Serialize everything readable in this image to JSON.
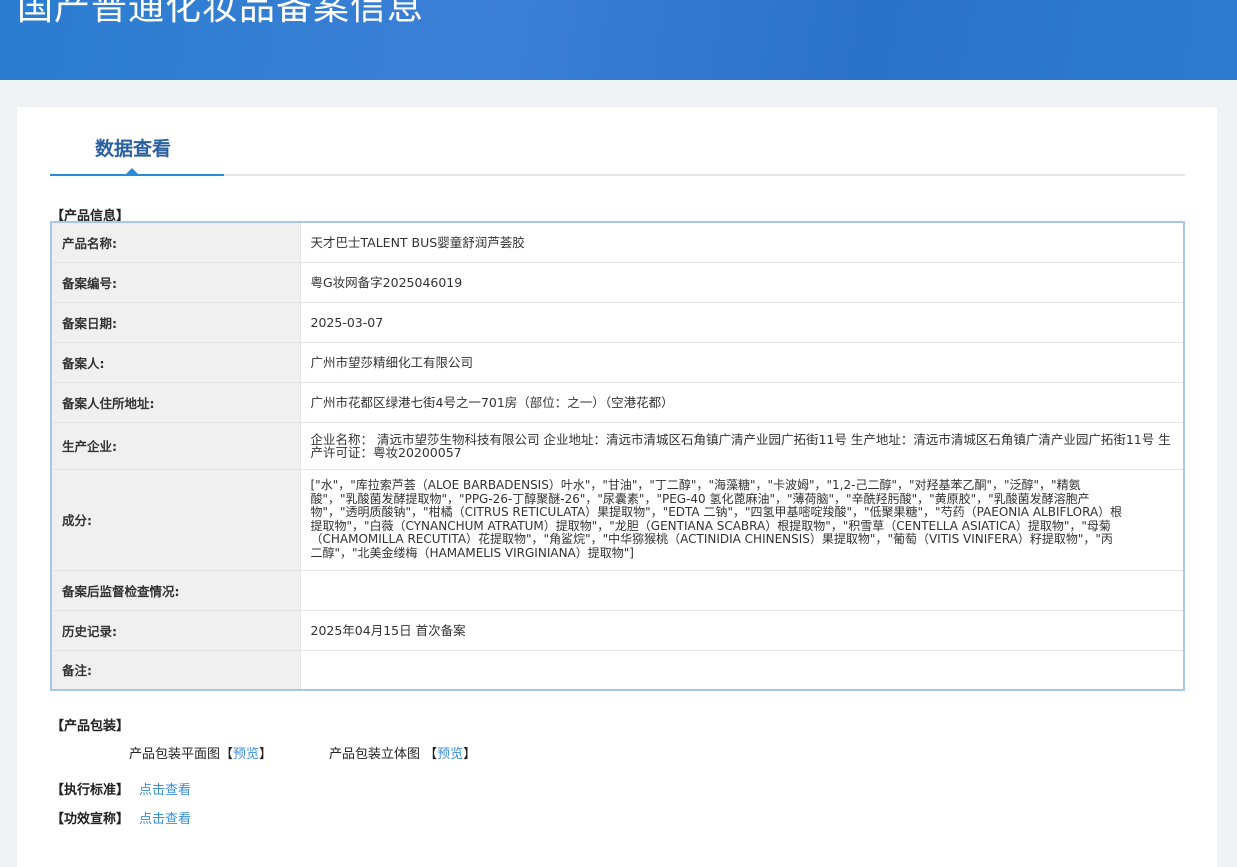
{
  "header": {
    "title": "国产普通化妆品备案信息"
  },
  "tab": {
    "label": "数据查看"
  },
  "product_info": {
    "section_title": "【产品信息】",
    "rows": [
      {
        "label": "产品名称:",
        "value": "天才巴士TALENT BUS婴童舒润芦荟胶"
      },
      {
        "label": "备案编号:",
        "value": "粤G妆网备字2025046019"
      },
      {
        "label": "备案日期:",
        "value": "2025-03-07"
      },
      {
        "label": "备案人:",
        "value": "广州市望莎精细化工有限公司"
      },
      {
        "label": "备案人住所地址:",
        "value": "广州市花都区绿港七街4号之一701房（部位：之一）（空港花都）"
      },
      {
        "label": "生产企业:",
        "value": "企业名称： 清远市望莎生物科技有限公司 企业地址：清远市清城区石角镇广清产业园广拓街11号 生产地址：清远市清城区石角镇广清产业园广拓街11号 生产许可证：粤妆20200057"
      },
      {
        "label": "成分:",
        "value": "[\"水\"，\"库拉索芦荟（ALOE BARBADENSIS）叶水\"，\"甘油\"，\"丁二醇\"，\"海藻糖\"，\"卡波姆\"，\"1,2-己二醇\"，\"对羟基苯乙酮\"，\"泛醇\"，\"精氨酸\"，\"乳酸菌发酵提取物\"，\"PPG-26-丁醇聚醚-26\"，\"尿囊素\"，\"PEG-40 氢化蓖麻油\"，\"薄荷脑\"，\"辛酰羟肟酸\"，\"黄原胶\"，\"乳酸菌发酵溶胞产物\"，\"透明质酸钠\"，\"柑橘（CITRUS RETICULATA）果提取物\"，\"EDTA 二钠\"，\"四氢甲基嘧啶羧酸\"，\"低聚果糖\"，\"芍药（PAEONIA ALBIFLORA）根提取物\"，\"白薇（CYNANCHUM ATRATUM）提取物\"，\"龙胆（GENTIANA SCABRA）根提取物\"，\"积雪草（CENTELLA ASIATICA）提取物\"，\"母菊（CHAMOMILLA RECUTITA）花提取物\"，\"角鲨烷\"，\"中华猕猴桃（ACTINIDIA CHINENSIS）果提取物\"，\"葡萄（VITIS VINIFERA）籽提取物\"，\"丙二醇\"，\"北美金缕梅（HAMAMELIS VIRGINIANA）提取物\"]"
      },
      {
        "label": "备案后监督检查情况:",
        "value": ""
      },
      {
        "label": "历史记录:",
        "value": "2025年04月15日 首次备案"
      },
      {
        "label": "备注:",
        "value": ""
      }
    ]
  },
  "packaging": {
    "section_title": "【产品包装】",
    "flat_label": "产品包装平面图【",
    "flat_link": "预览",
    "flat_close": "】",
    "stereo_label": "产品包装立体图 【",
    "stereo_link": "预览",
    "stereo_close": "】"
  },
  "standard": {
    "section_title": "【执行标准】",
    "link": "点击查看"
  },
  "efficacy": {
    "section_title": "【功效宣称】",
    "link": "点击查看"
  }
}
